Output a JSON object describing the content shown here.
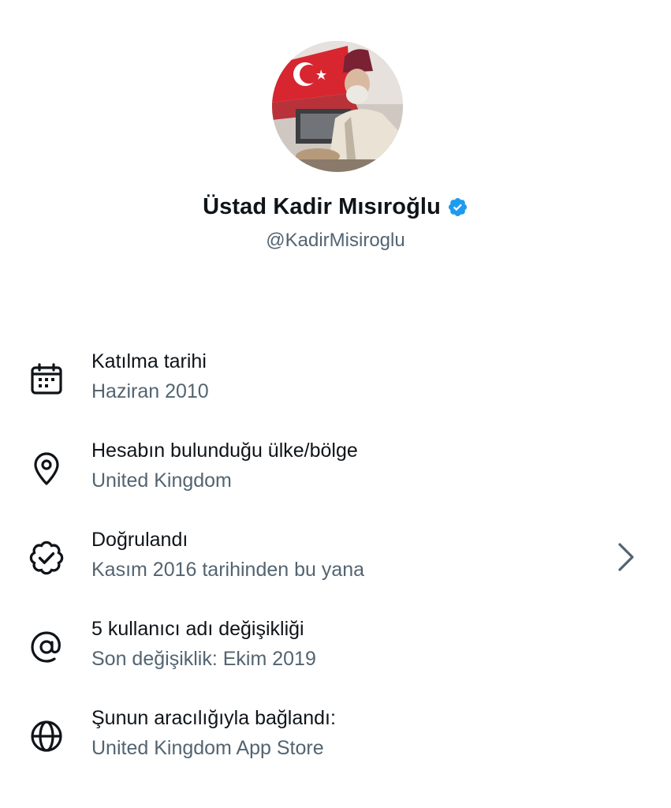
{
  "profile": {
    "display_name": "Üstad Kadir Mısıroğlu",
    "handle": "@KadirMisiroglu",
    "verified_color": "#1d9bf0"
  },
  "about": {
    "items": [
      {
        "icon": "calendar-icon",
        "title": "Katılma tarihi",
        "subtitle": "Haziran 2010"
      },
      {
        "icon": "location-pin-icon",
        "title": "Hesabın bulunduğu ülke/bölge",
        "subtitle": "United Kingdom"
      },
      {
        "icon": "verified-outline-icon",
        "title": "Doğrulandı",
        "subtitle": "Kasım 2016 tarihinden bu yana",
        "has_chevron": true
      },
      {
        "icon": "at-sign-icon",
        "title": "5 kullanıcı adı değişikliği",
        "subtitle": "Son değişiklik: Ekim 2019"
      },
      {
        "icon": "globe-icon",
        "title": "Şunun aracılığıyla bağlandı:",
        "subtitle": "United Kingdom App Store"
      }
    ]
  },
  "colors": {
    "primary_text": "#0f1419",
    "secondary_text": "#536471",
    "accent": "#1d9bf0"
  }
}
